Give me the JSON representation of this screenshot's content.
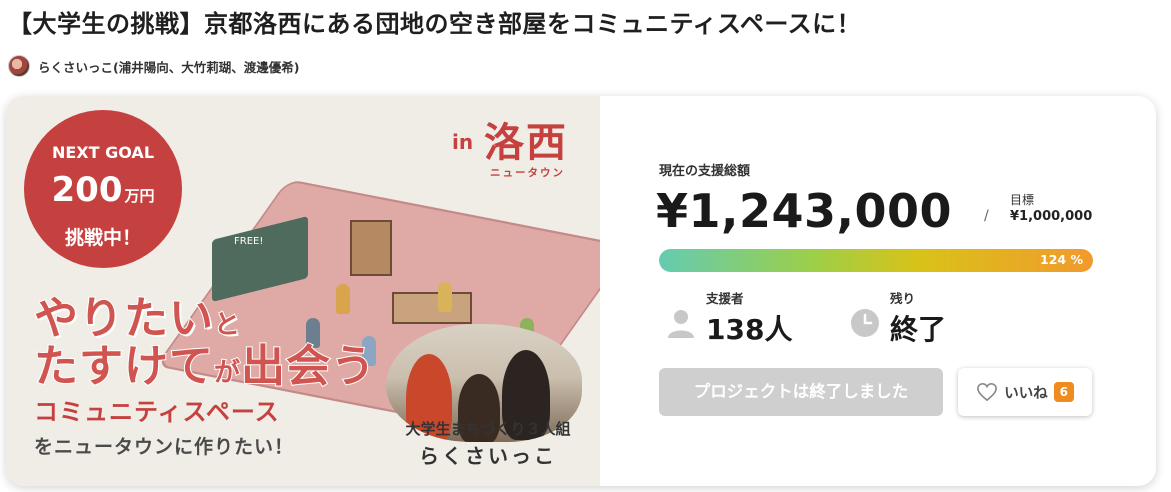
{
  "project": {
    "title": "【大学生の挑戦】京都洛西にある団地の空き部屋をコミュニティスペースに！",
    "owner": "らくさいっこ(浦井陽向、大竹莉瑚、渡邊優希)"
  },
  "visual": {
    "goal_top": "NEXT GOAL",
    "goal_amount": "200",
    "goal_unit": "万円",
    "goal_bottom": "挑戦中！",
    "in_label": "in",
    "place": "洛西",
    "place_sub": "ニュータウン",
    "board_text": "FREE!",
    "tagline_1a": "やりたい",
    "tagline_1b": "と",
    "tagline_2a": "たすけて",
    "tagline_2b": "が",
    "tagline_2c": "出会う",
    "community": "コミュニティスペース",
    "build_line": "をニュータウンに作りたい！",
    "team_label": "大学生まちづくり３人組",
    "team_name": "らくさいっこ"
  },
  "funding": {
    "total_label": "現在の支援総額",
    "total_amount": "¥1,243,000",
    "slash": "/",
    "target_label": "目標",
    "target_amount": "¥1,000,000",
    "percent_text": "124 %",
    "percent_value": 124
  },
  "stats": {
    "supporters_label": "支援者",
    "supporters_value": "138人",
    "remaining_label": "残り",
    "remaining_value": "終了"
  },
  "actions": {
    "ended_label": "プロジェクトは終了しました",
    "like_label": "いいね",
    "like_count": "6"
  },
  "colors": {
    "brand_red": "#c5413f",
    "like_badge": "#f08c1d",
    "disabled_button": "#cfcfcf"
  },
  "icons": {
    "supporters": "person-icon",
    "remaining": "clock-icon",
    "like": "heart-icon"
  }
}
